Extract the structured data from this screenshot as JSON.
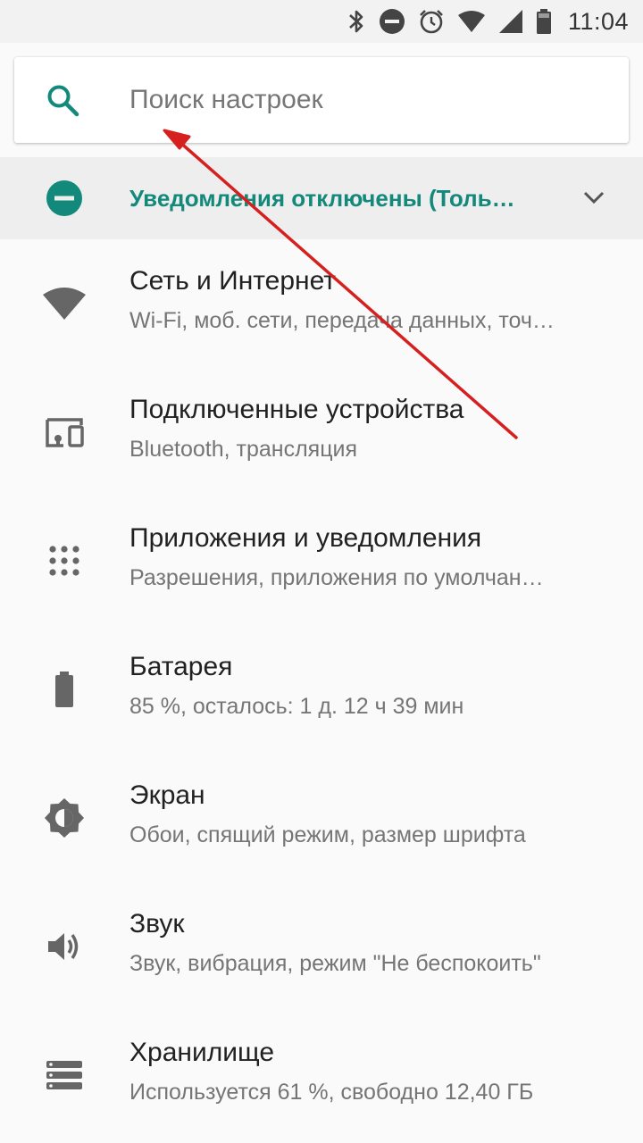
{
  "status_bar": {
    "time": "11:04",
    "icons": [
      "bluetooth-icon",
      "do-not-disturb-icon",
      "alarm-icon",
      "wifi-icon",
      "signal-icon",
      "battery-icon"
    ]
  },
  "search": {
    "placeholder": "Поиск настроек"
  },
  "suggestion": {
    "text": "Уведомления отключены (Толь…",
    "color": "#12897b"
  },
  "settings_items": [
    {
      "icon": "wifi-icon",
      "title": "Сеть и Интернет",
      "subtitle": "Wi-Fi, моб. сети, передача данных, точ…"
    },
    {
      "icon": "connected-devices-icon",
      "title": "Подключенные устройства",
      "subtitle": "Bluetooth, трансляция"
    },
    {
      "icon": "apps-grid-icon",
      "title": "Приложения и уведомления",
      "subtitle": "Разрешения, приложения по умолчан…"
    },
    {
      "icon": "battery-icon",
      "title": "Батарея",
      "subtitle": "85 %, осталось: 1 д. 12 ч 39 мин"
    },
    {
      "icon": "brightness-icon",
      "title": "Экран",
      "subtitle": "Обои, спящий режим, размер шрифта"
    },
    {
      "icon": "volume-icon",
      "title": "Звук",
      "subtitle": "Звук, вибрация, режим \"Не беспокоить\""
    },
    {
      "icon": "storage-icon",
      "title": "Хранилище",
      "subtitle": "Используется 61 %, свободно 12,40 ГБ"
    }
  ],
  "colors": {
    "accent": "#12897b",
    "annotation_arrow": "#d62020"
  }
}
